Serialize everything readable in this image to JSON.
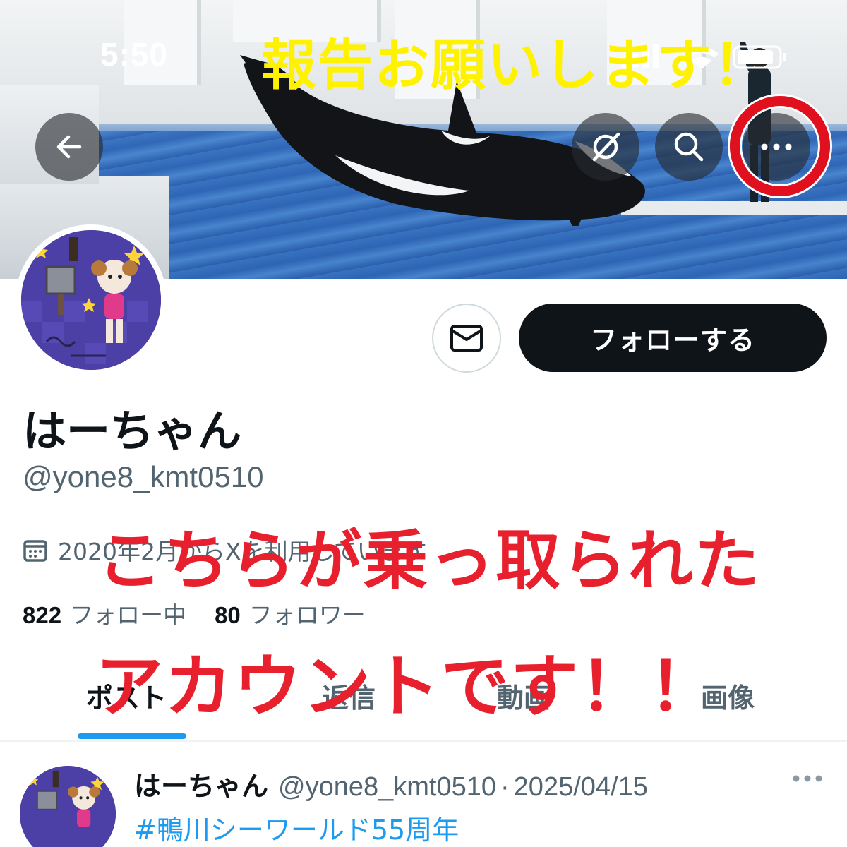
{
  "status_bar": {
    "time": "5:50"
  },
  "banner": {
    "description_icon": "orca-show-photo"
  },
  "annotations": {
    "top_notice": "報告お願いします！",
    "hijacked_line1": "こちらが乗っ取られた",
    "hijacked_line2": "アカウントです！！",
    "highlight_target": "more-options"
  },
  "header_actions": {
    "back_icon": "arrow-left-icon",
    "grok_icon": "grok-icon",
    "search_icon": "search-icon",
    "more_icon": "more-horizontal-icon"
  },
  "profile": {
    "display_name": "はーちゃん",
    "handle": "@yone8_kmt0510",
    "joined": "2020年2月からXを利用しています",
    "following_count": "822",
    "following_label": "フォロー中",
    "followers_count": "80",
    "followers_label": "フォロワー"
  },
  "actions": {
    "follow_label": "フォローする",
    "dm_icon": "envelope-icon"
  },
  "tabs": [
    {
      "label": "ポスト",
      "active": true
    },
    {
      "label": "返信",
      "active": false
    },
    {
      "label": "動画",
      "active": false
    },
    {
      "label": "画像",
      "active": false
    }
  ],
  "post": {
    "author_name": "はーちゃん",
    "author_handle": "@yone8_kmt0510",
    "separator": "·",
    "date": "2025/04/15",
    "hashtag": "#鴨川シーワールド55周年"
  },
  "colors": {
    "accent": "#1d9bf0",
    "text_primary": "#0f1419",
    "text_secondary": "#536471",
    "overlay_red": "#e8202d",
    "overlay_yellow": "#fff200"
  }
}
